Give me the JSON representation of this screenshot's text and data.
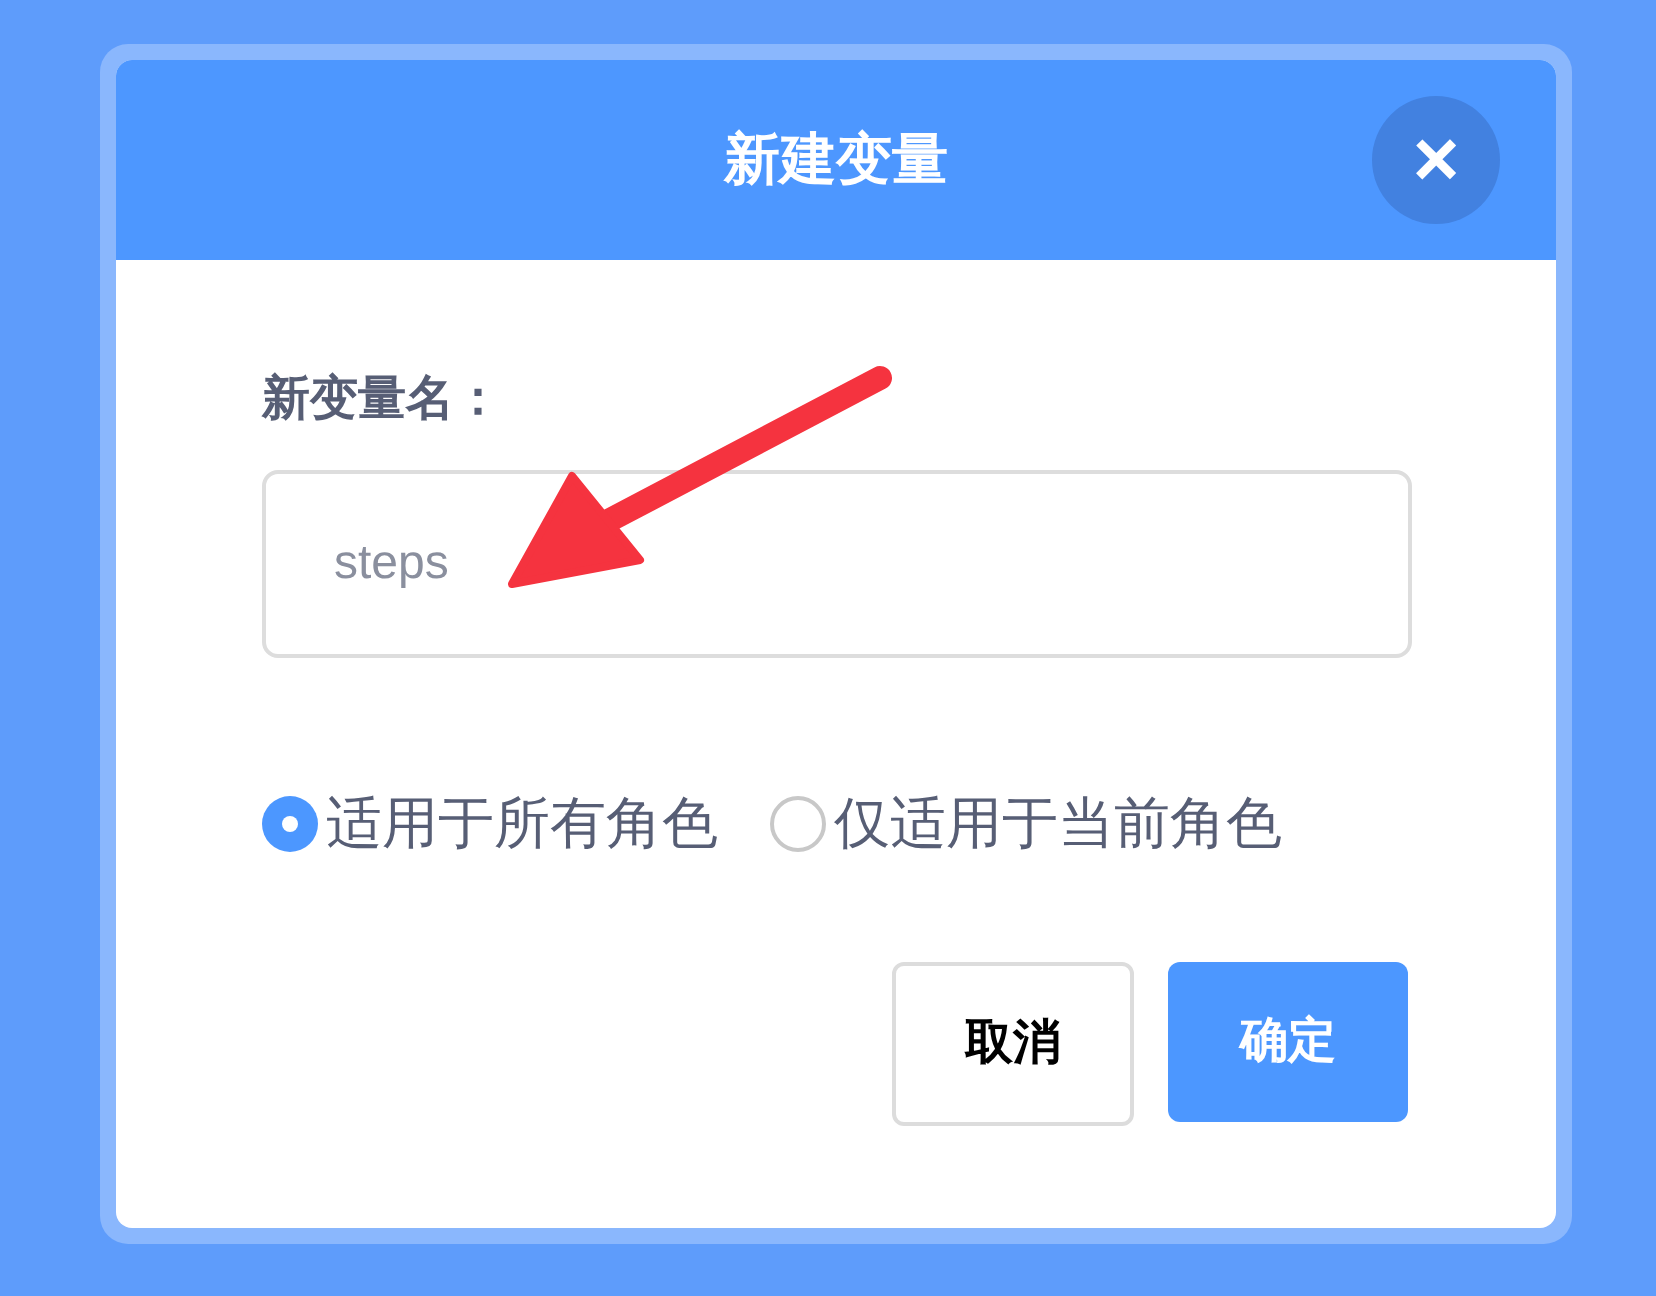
{
  "dialog": {
    "title": "新建变量",
    "close_button": "×",
    "name_label": "新变量名：",
    "name_field": {
      "value": "steps"
    },
    "scope_options": [
      {
        "label": "适用于所有角色",
        "selected": true
      },
      {
        "label": "仅适用于当前角色",
        "selected": false
      }
    ],
    "buttons": [
      {
        "label": "取消",
        "kind": "secondary"
      },
      {
        "label": "确定",
        "kind": "primary"
      }
    ]
  }
}
